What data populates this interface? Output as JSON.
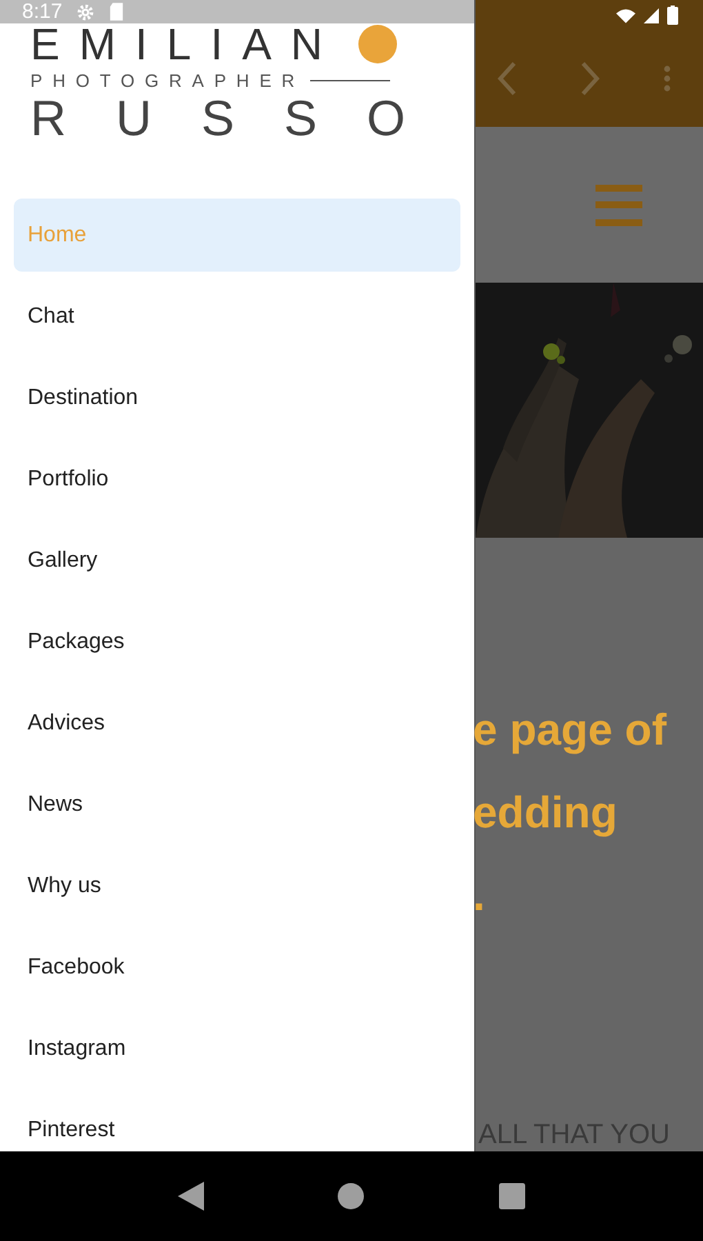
{
  "status_bar": {
    "time": "8:17"
  },
  "logo": {
    "first_name": "EMILIAN",
    "tagline": "PHOTOGRAPHER",
    "last_name": "RUSSO"
  },
  "menu": [
    {
      "label": "Home",
      "selected": true
    },
    {
      "label": "Chat",
      "selected": false
    },
    {
      "label": "Destination",
      "selected": false
    },
    {
      "label": "Portfolio",
      "selected": false
    },
    {
      "label": "Gallery",
      "selected": false
    },
    {
      "label": "Packages",
      "selected": false
    },
    {
      "label": "Advices",
      "selected": false
    },
    {
      "label": "News",
      "selected": false
    },
    {
      "label": "Why us",
      "selected": false
    },
    {
      "label": "Facebook",
      "selected": false
    },
    {
      "label": "Instagram",
      "selected": false
    },
    {
      "label": "Pinterest",
      "selected": false
    }
  ],
  "page": {
    "heading_lines": [
      "e page of",
      "edding",
      "."
    ],
    "footer_text": "ALL THAT YOU"
  }
}
